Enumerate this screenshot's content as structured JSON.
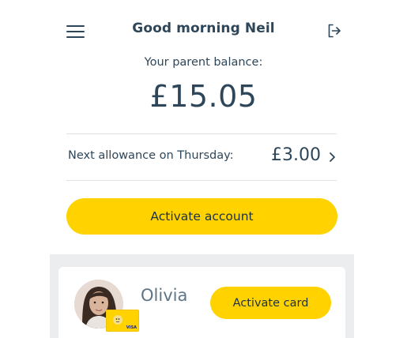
{
  "header": {
    "greeting": "Good morning Neil",
    "menu_icon": "hamburger-menu-icon",
    "logout_icon": "logout-icon"
  },
  "balance": {
    "label": "Your parent balance:",
    "amount": "£15.05"
  },
  "allowance": {
    "label": "Next allowance on Thursday:",
    "amount": "£3.00",
    "icon": "chevron-right-icon"
  },
  "actions": {
    "activate_account_label": "Activate account"
  },
  "children": [
    {
      "name": "Olivia",
      "activate_card_label": "Activate card",
      "card_brand": "VISA"
    }
  ],
  "colors": {
    "accent": "#ffd200",
    "text": "#2e4659",
    "panel": "#ebedef",
    "divider": "#dfe3e6"
  }
}
